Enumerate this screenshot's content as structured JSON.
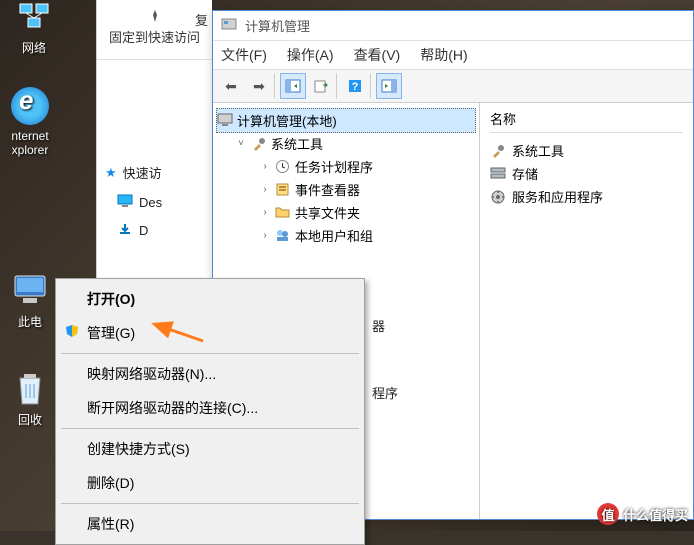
{
  "desktop": {
    "icons": {
      "network": "网络",
      "ie_line1": "nternet",
      "ie_line2": "xplorer",
      "thispc": "此电",
      "recycle": "回收"
    }
  },
  "explorer_panel": {
    "pin": "固定到快速访问",
    "copy_fragment": "复",
    "quick_access": "快速访",
    "desktop_item": "Des",
    "item_d": "D"
  },
  "mgmt": {
    "title": "计算机管理",
    "menu": {
      "file": "文件(F)",
      "action": "操作(A)",
      "view": "查看(V)",
      "help": "帮助(H)"
    },
    "tree": {
      "root": "计算机管理(本地)",
      "sys_tools": "系统工具",
      "task_scheduler": "任务计划程序",
      "event_viewer": "事件查看器",
      "shared_folders": "共享文件夹",
      "local_users": "本地用户和组"
    },
    "right": {
      "header": "名称",
      "sys_tools": "系统工具",
      "storage": "存储",
      "services": "服务和应用程序"
    },
    "partial": {
      "qi": "器",
      "chengxu": "程序"
    }
  },
  "context_menu": {
    "open": "打开(O)",
    "manage": "管理(G)",
    "map_drive": "映射网络驱动器(N)...",
    "disconnect": "断开网络驱动器的连接(C)...",
    "shortcut": "创建快捷方式(S)",
    "delete": "删除(D)",
    "properties": "属性(R)"
  },
  "watermark": {
    "badge": "值",
    "text": "什么值得买"
  }
}
